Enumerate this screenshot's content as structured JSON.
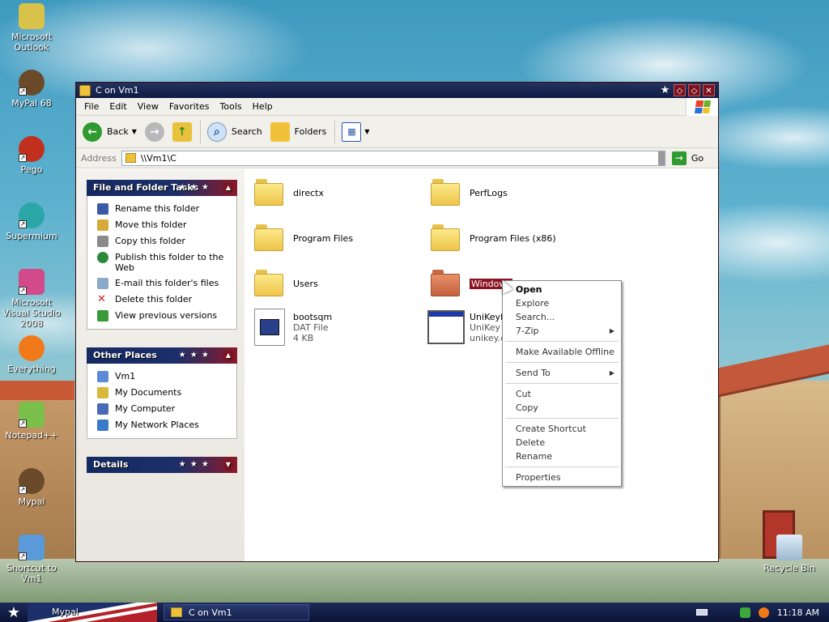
{
  "desktop": {
    "icons": [
      {
        "label": "Microsoft Outlook",
        "icon": "outlook-icon",
        "color": "#d9c24a"
      },
      {
        "label": "MyPal 68",
        "icon": "mypal-icon",
        "color": "#6b4a2a"
      },
      {
        "label": "Pego",
        "icon": "pego-icon",
        "color": "#c0301c"
      },
      {
        "label": "Supermium",
        "icon": "supermium-icon",
        "color": "#2aa6a6"
      },
      {
        "label": "Microsoft Visual Studio 2008",
        "icon": "visual-studio-icon",
        "color": "#d24a8a"
      },
      {
        "label": "Everything",
        "icon": "everything-icon",
        "color": "#f07a1a"
      },
      {
        "label": "Notepad++",
        "icon": "notepadpp-icon",
        "color": "#7ac04a"
      },
      {
        "label": "Mypal",
        "icon": "mypal-icon",
        "color": "#6b4a2a"
      },
      {
        "label": "Shortcut to Vm1",
        "icon": "computer-icon",
        "color": "#5a9ad8"
      }
    ],
    "recycle_bin": "Recycle Bin"
  },
  "window": {
    "title": "C on Vm1",
    "menu": [
      "File",
      "Edit",
      "View",
      "Favorites",
      "Tools",
      "Help"
    ],
    "toolbar": {
      "back": "Back",
      "search": "Search",
      "folders": "Folders"
    },
    "address": {
      "label": "Address",
      "value": "\\\\Vm1\\C",
      "go": "Go"
    }
  },
  "taskpane": {
    "file_tasks": {
      "title": "File and Folder Tasks",
      "items": [
        {
          "label": "Rename this folder",
          "icon": "rename-icon",
          "color": "#3a5aa8"
        },
        {
          "label": "Move this folder",
          "icon": "move-icon",
          "color": "#d8a83a"
        },
        {
          "label": "Copy this folder",
          "icon": "copy-icon",
          "color": "#8a8a8a"
        },
        {
          "label": "Publish this folder to the Web",
          "icon": "globe-icon",
          "color": "#2a8a3a"
        },
        {
          "label": "E-mail this folder's files",
          "icon": "email-icon",
          "color": "#8aa8c8"
        },
        {
          "label": "Delete this folder",
          "icon": "delete-icon",
          "color": "#c82020"
        },
        {
          "label": "View previous versions",
          "icon": "history-icon",
          "color": "#3a9a3a"
        }
      ]
    },
    "other_places": {
      "title": "Other Places",
      "items": [
        {
          "label": "Vm1",
          "icon": "computer-icon",
          "color": "#5a8ad8"
        },
        {
          "label": "My Documents",
          "icon": "documents-icon",
          "color": "#d8b83a"
        },
        {
          "label": "My Computer",
          "icon": "my-computer-icon",
          "color": "#4a6ab8"
        },
        {
          "label": "My Network Places",
          "icon": "network-icon",
          "color": "#3a7ac8"
        }
      ]
    },
    "details": {
      "title": "Details"
    }
  },
  "content": {
    "items": [
      {
        "name": "directx",
        "type": "folder"
      },
      {
        "name": "PerfLogs",
        "type": "folder"
      },
      {
        "name": "Program Files",
        "type": "folder"
      },
      {
        "name": "Program Files (x86)",
        "type": "folder"
      },
      {
        "name": "Users",
        "type": "folder"
      },
      {
        "name": "Windows",
        "type": "folder",
        "selected": true
      },
      {
        "name": "bootsqm",
        "type": "file",
        "line2": "DAT File",
        "line3": "4 KB"
      },
      {
        "name": "UniKeyN",
        "type": "app",
        "line2": "UniKey I",
        "line3": "unikey.c"
      }
    ]
  },
  "context_menu": {
    "groups": [
      [
        {
          "label": "Open",
          "default": true
        },
        {
          "label": "Explore"
        },
        {
          "label": "Search..."
        },
        {
          "label": "7-Zip",
          "submenu": true
        }
      ],
      [
        {
          "label": "Make Available Offline"
        }
      ],
      [
        {
          "label": "Send To",
          "submenu": true
        }
      ],
      [
        {
          "label": "Cut"
        },
        {
          "label": "Copy"
        }
      ],
      [
        {
          "label": "Create Shortcut"
        },
        {
          "label": "Delete"
        },
        {
          "label": "Rename"
        }
      ],
      [
        {
          "label": "Properties"
        }
      ]
    ]
  },
  "taskbar": {
    "pinned_label": "Mypal",
    "window_button": "C on Vm1",
    "clock": "11:18 AM"
  },
  "colors": {
    "title_bar": "#0e1b44",
    "selection": "#8a1422",
    "panel_header": "#142a60"
  }
}
